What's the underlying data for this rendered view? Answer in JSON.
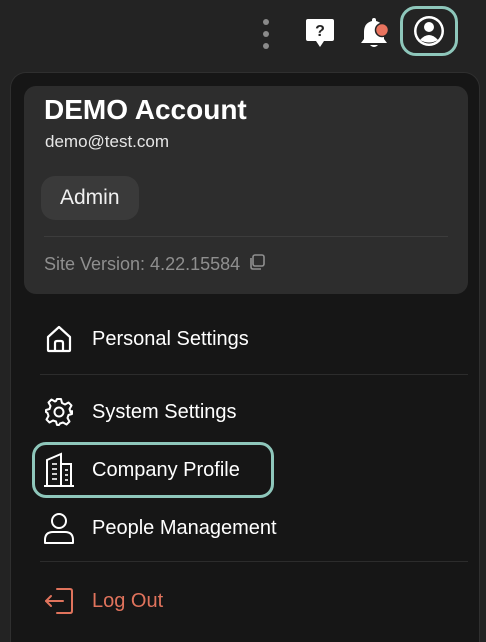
{
  "topbar": {
    "icons": [
      "kebab-menu-icon",
      "help-icon",
      "notification-bell-icon",
      "user-profile-icon"
    ],
    "help_glyph": "?",
    "notification_dot_color": "#e8735e"
  },
  "account": {
    "name": "DEMO Account",
    "email": "demo@test.com",
    "role": "Admin",
    "version_label": "Site Version: 4.22.15584"
  },
  "menu": {
    "personal_settings": "Personal Settings",
    "system_settings": "System Settings",
    "company_profile": "Company Profile",
    "people_management": "People Management",
    "log_out": "Log Out"
  },
  "colors": {
    "accent": "#8ec7bb",
    "danger": "#e0735c",
    "panel_bg": "#161616",
    "card_bg": "#2d2d2d"
  }
}
